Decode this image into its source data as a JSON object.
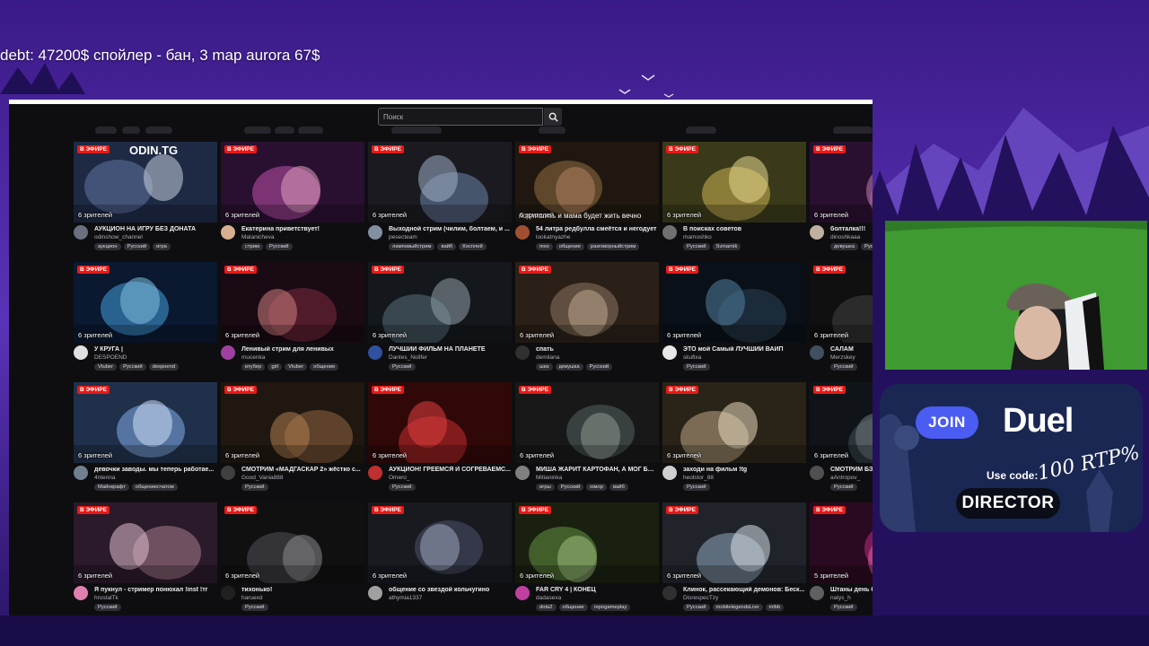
{
  "overlay": {
    "status_text": "debt: 47200$ спойлер - бан, 3 map aurora 67$"
  },
  "browser": {
    "search": {
      "placeholder": "Поиск",
      "value": ""
    }
  },
  "colors": {
    "live_badge": "#e91916",
    "page_bg": "#0e0e10",
    "tag_bg": "#2f2f35",
    "promo_join": "#4a5cf2"
  },
  "live_label": "В ЭФИРЕ",
  "cards": [
    {
      "title": "АУКЦИОН НА ИГРУ БЕЗ ДОНАТА",
      "channel": "odinshow_channel",
      "viewers": "6 зрителей",
      "tags": [
        "аукцион",
        "Русский",
        "игра"
      ],
      "thumb_text": "ODIN.TG"
    },
    {
      "title": "Екатерина приветствует!",
      "channel": "Malanicheva",
      "viewers": "6 зрителей",
      "tags": [
        "стрим",
        "Русский"
      ]
    },
    {
      "title": "Выходной стрим (чилим, болтаем, и ...",
      "channel": "pesecteam",
      "viewers": "6 зрителей",
      "tags": [
        "ламповыйстрим",
        "вайб",
        "Косплей"
      ]
    },
    {
      "title": "54 литра редбулла смеётся и негодует",
      "channel": "lookatnyazhe",
      "viewers": "6 зрителей",
      "tags": [
        "пою",
        "общение",
        "разговорныйстрим"
      ],
      "thumb_text": "подпишись и мама будет жить вечно"
    },
    {
      "title": "В поисках советов",
      "channel": "mamoshko",
      "viewers": "6 зрителей",
      "tags": [
        "Русский",
        "Svinarnik"
      ]
    },
    {
      "title": "болталка!!!",
      "channel": "dinoshkaaa",
      "viewers": "6 зрителей",
      "tags": [
        "девушка",
        "Русский"
      ]
    },
    {
      "title": "У КРУГА |",
      "channel": "DESPOEND",
      "viewers": "6 зрителей",
      "tags": [
        "Vtuber",
        "Русский",
        "despoend"
      ]
    },
    {
      "title": "Ленивый стрим для ленивых",
      "channel": "mucenka",
      "viewers": "6 зрителей",
      "tags": [
        "втубер",
        "girl",
        "Vtuber",
        "общение"
      ]
    },
    {
      "title": "ЛУЧШИЙ ФИЛЬМ НА ПЛАНЕТЕ",
      "channel": "Dantes_Nolifer",
      "viewers": "6 зрителей",
      "tags": [
        "Русский"
      ]
    },
    {
      "title": "спать",
      "channel": "demilana",
      "viewers": "6 зрителей",
      "tags": [
        "шиз",
        "девушка",
        "Русский"
      ]
    },
    {
      "title": "ЭТО мой Самый ЛУЧШИЙ ВАЙП",
      "channel": "skufixa",
      "viewers": "6 зрителей",
      "tags": [
        "Русский"
      ]
    },
    {
      "title": "САЛАМ",
      "channel": "Merzskey",
      "viewers": "6 зрителей",
      "tags": [
        "Русский"
      ]
    },
    {
      "title": "девочки заводы. мы теперь работае...",
      "channel": "4ntenna",
      "viewers": "6 зрителей",
      "tags": [
        "Майнкрафт",
        "общениесчатом"
      ]
    },
    {
      "title": "СМОТРИМ «МАДГАСКАР 2» жёстко с...",
      "channel": "Good_Vania888",
      "viewers": "6 зрителей",
      "tags": [
        "Русский"
      ]
    },
    {
      "title": "АУКЦИОН! ГРЕЕМСЯ И СОГРЕВАЕМС...",
      "channel": "Omero_",
      "viewers": "6 зрителей",
      "tags": [
        "Русский"
      ]
    },
    {
      "title": "МИША ЖАРИТ КАРТОФАН, А МОГ БЫ...",
      "channel": "Mitianinka",
      "viewers": "6 зрителей",
      "tags": [
        "игры",
        "Русский",
        "юмор",
        "вайб"
      ]
    },
    {
      "title": "заходи на фильм !tg",
      "channel": "heolstor_88",
      "viewers": "6 зрителей",
      "tags": [
        "Русский"
      ]
    },
    {
      "title": "СМОТРИМ БЭ",
      "channel": "aAntropov_",
      "viewers": "6 зрителей",
      "tags": [
        "Русский"
      ]
    },
    {
      "title": "Я пукнул - стример понюхал !inst !тг",
      "channel": "hrustalTk",
      "viewers": "6 зрителей",
      "tags": [
        "Русский"
      ]
    },
    {
      "title": "тихонько!",
      "channel": "haruexd",
      "viewers": "6 зрителей",
      "tags": [
        "Русский"
      ]
    },
    {
      "title": "общение со звездой кольчугино",
      "channel": "athymia1337",
      "viewers": "6 зрителей",
      "tags": []
    },
    {
      "title": "FAR CRY 4 | КОНЕЦ",
      "channel": "dadasexa",
      "viewers": "6 зрителей",
      "tags": [
        "dota2",
        "общение",
        "repogameplay"
      ]
    },
    {
      "title": "Клинок, рассекающий демонов: Беск...",
      "channel": "DisrespecTzy",
      "viewers": "6 зрителей",
      "tags": [
        "Русский",
        "mobilelegendsLive",
        "mlbb"
      ]
    },
    {
      "title": "Штаны день 6",
      "channel": "natys_h",
      "viewers": "5 зрителей",
      "tags": [
        "Русский"
      ]
    }
  ],
  "promo": {
    "join_label": "JOIN",
    "brand": "Duel",
    "use_code_label": "Use code:",
    "rtp_text": "100 RTP%",
    "code": "DIRECTOR"
  }
}
